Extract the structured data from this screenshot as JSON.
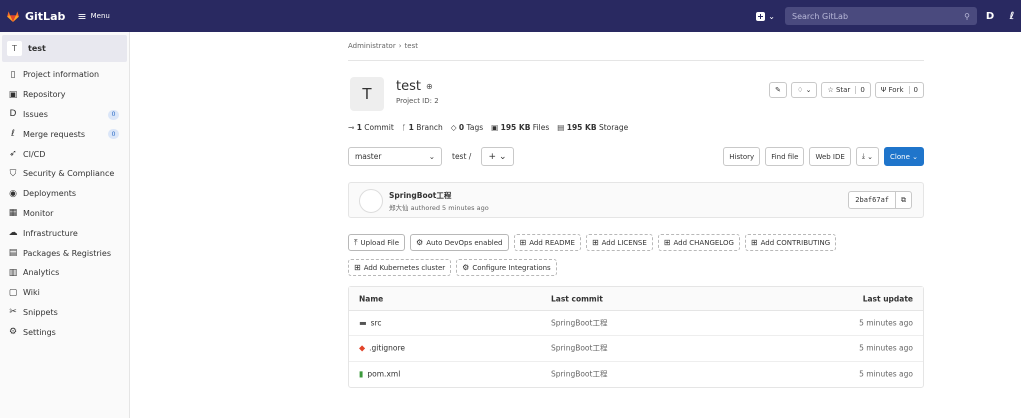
{
  "topbar": {
    "app_name": "GitLab",
    "menu_label": "Menu",
    "search_placeholder": "Search GitLab",
    "accent": "#292961"
  },
  "sidebar": {
    "project_initial": "T",
    "project_name": "test",
    "items": [
      {
        "label": "Project information",
        "icon": "info-icon"
      },
      {
        "label": "Repository",
        "icon": "book-icon"
      },
      {
        "label": "Issues",
        "icon": "issues-icon",
        "badge": "0"
      },
      {
        "label": "Merge requests",
        "icon": "merge-request-icon",
        "badge": "0"
      },
      {
        "label": "CI/CD",
        "icon": "rocket-icon"
      },
      {
        "label": "Security & Compliance",
        "icon": "shield-icon"
      },
      {
        "label": "Deployments",
        "icon": "deployments-icon"
      },
      {
        "label": "Monitor",
        "icon": "monitor-icon"
      },
      {
        "label": "Infrastructure",
        "icon": "cloud-icon"
      },
      {
        "label": "Packages & Registries",
        "icon": "package-icon"
      },
      {
        "label": "Analytics",
        "icon": "chart-icon"
      },
      {
        "label": "Wiki",
        "icon": "wiki-icon"
      },
      {
        "label": "Snippets",
        "icon": "scissors-icon"
      },
      {
        "label": "Settings",
        "icon": "gear-icon"
      }
    ]
  },
  "breadcrumb": {
    "root": "Administrator",
    "current": "test"
  },
  "project": {
    "initial": "T",
    "name": "test",
    "id_label": "Project ID: 2"
  },
  "header_actions": {
    "star_label": "Star",
    "star_count": "0",
    "fork_label": "Fork",
    "fork_count": "0"
  },
  "stats": {
    "commits": {
      "value": "1",
      "label": "Commit"
    },
    "branches": {
      "value": "1",
      "label": "Branch"
    },
    "tags": {
      "value": "0",
      "label": "Tags"
    },
    "files": {
      "value": "195 KB",
      "label": "Files"
    },
    "storage": {
      "value": "195 KB",
      "label": "Storage"
    }
  },
  "toolbar": {
    "branch": "master",
    "path": "test",
    "path_sep": "/",
    "history": "History",
    "find_file": "Find file",
    "web_ide": "Web IDE",
    "clone": "Clone"
  },
  "last_commit": {
    "title": "SpringBoot工程",
    "meta": "郑大仙 authored 5 minutes ago",
    "sha": "2baf67af"
  },
  "quick_actions_row1": [
    {
      "label": "Upload File",
      "icon": "upload-icon",
      "solid": true
    },
    {
      "label": "Auto DevOps enabled",
      "icon": "gear-icon",
      "solid": true
    },
    {
      "label": "Add README",
      "icon": "plus-square-icon"
    },
    {
      "label": "Add LICENSE",
      "icon": "plus-square-icon"
    },
    {
      "label": "Add CHANGELOG",
      "icon": "plus-square-icon"
    },
    {
      "label": "Add CONTRIBUTING",
      "icon": "plus-square-icon"
    }
  ],
  "quick_actions_row2": [
    {
      "label": "Add Kubernetes cluster",
      "icon": "plus-square-icon"
    },
    {
      "label": "Configure Integrations",
      "icon": "gear-icon"
    }
  ],
  "file_table": {
    "headers": {
      "name": "Name",
      "last_commit": "Last commit",
      "last_update": "Last update"
    },
    "rows": [
      {
        "name": "src",
        "type": "folder",
        "commit": "SpringBoot工程",
        "updated": "5 minutes ago"
      },
      {
        "name": ".gitignore",
        "type": "git",
        "commit": "SpringBoot工程",
        "updated": "5 minutes ago"
      },
      {
        "name": "pom.xml",
        "type": "xml",
        "commit": "SpringBoot工程",
        "updated": "5 minutes ago"
      }
    ]
  }
}
